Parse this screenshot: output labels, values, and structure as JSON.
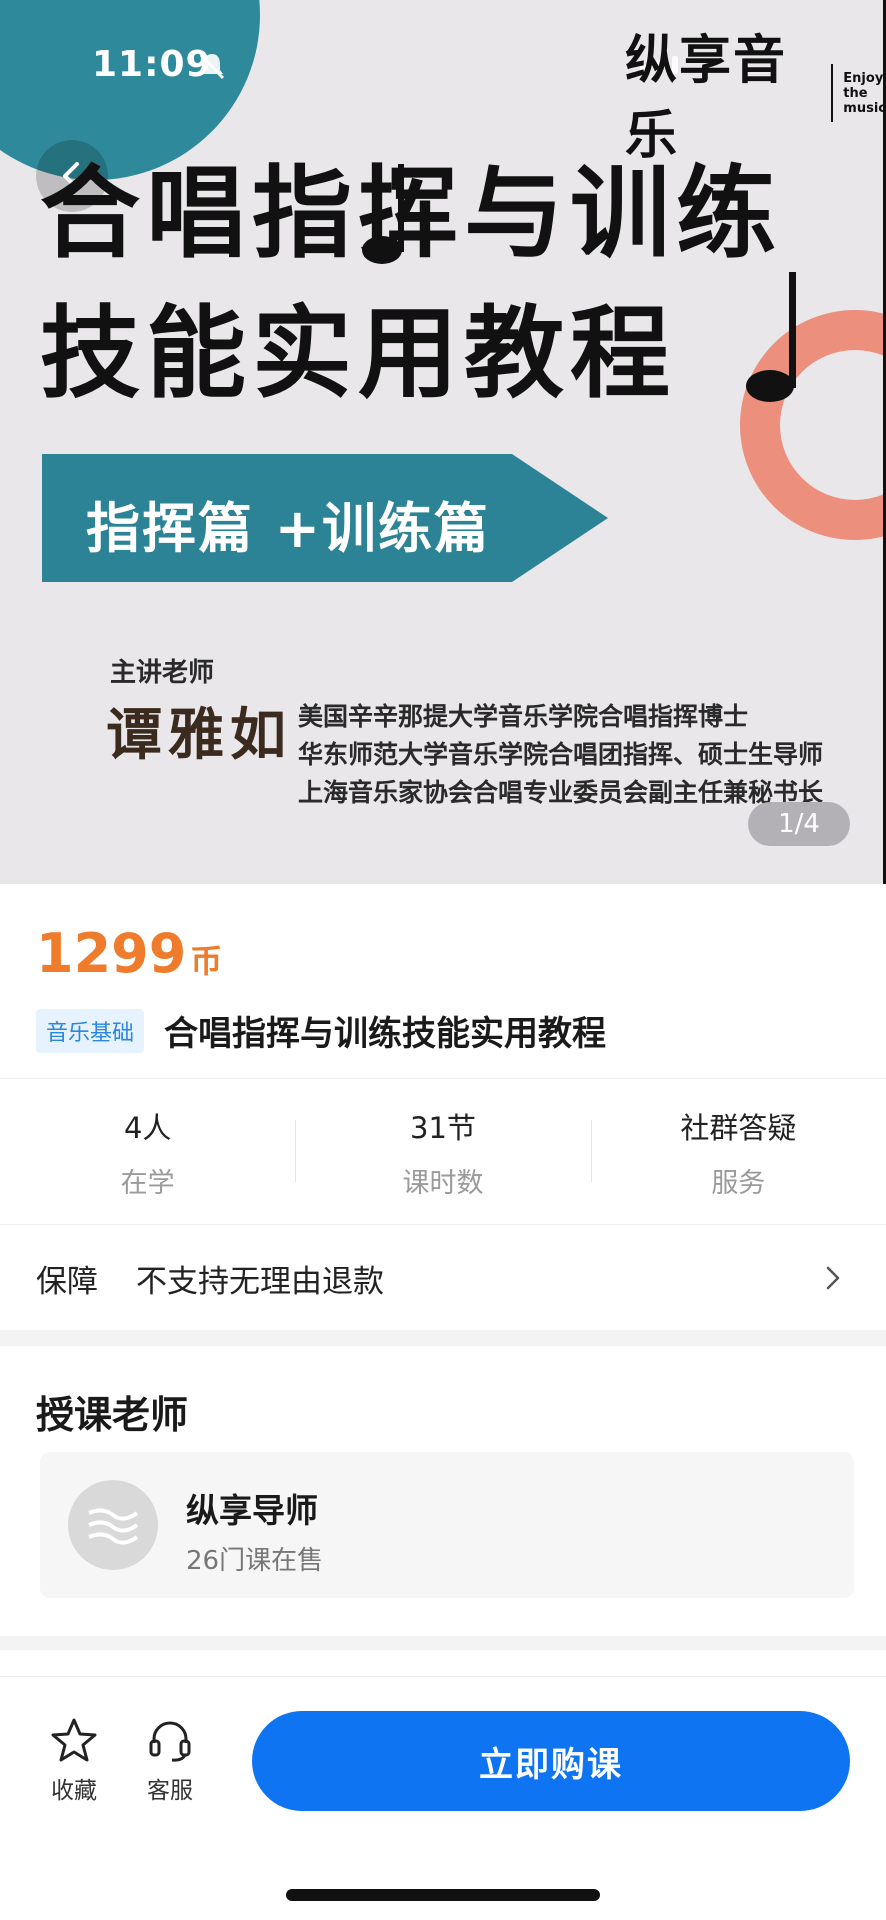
{
  "status_bar": {
    "time": "11:09"
  },
  "hero": {
    "brand_cn": "纵享音乐",
    "brand_en_lines": [
      "Enjoy",
      "the",
      "music"
    ],
    "title_line1": "合唱指挥与训练",
    "title_line2": "技能实用教程",
    "banner_text": "指挥篇 +训练篇",
    "teacher_caption": "主讲老师",
    "teacher_name": "谭雅如",
    "teacher_credentials": [
      "美国辛辛那提大学音乐学院合唱指挥博士",
      "华东师范大学音乐学院合唱团指挥、硕士生导师",
      "上海音乐家协会合唱专业委员会副主任兼秘书长"
    ],
    "image_counter": "1/4",
    "colors": {
      "teal": "#2b8395",
      "salmon": "#ec8f7d"
    }
  },
  "product": {
    "price": "1299",
    "price_unit": "币",
    "category_tag": "音乐基础",
    "title": "合唱指挥与训练技能实用教程",
    "accent_color": "#ef7b2c"
  },
  "stats": [
    {
      "value": "4人",
      "label": "在学"
    },
    {
      "value": "31节",
      "label": "课时数"
    },
    {
      "value": "社群答疑",
      "label": "服务"
    }
  ],
  "guarantee": {
    "label": "保障",
    "value": "不支持无理由退款"
  },
  "teacher_section": {
    "title": "授课老师",
    "name": "纵享导师",
    "subtitle": "26门课在售"
  },
  "bottom_bar": {
    "favorite_label": "收藏",
    "service_label": "客服",
    "buy_label": "立即购课",
    "buy_color": "#0e74f2"
  }
}
